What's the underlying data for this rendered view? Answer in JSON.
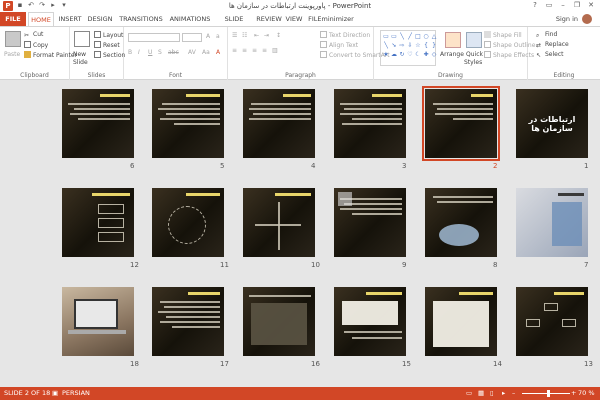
{
  "window": {
    "title": "پاورپوینت ارتباطات در سازمان ها - PowerPoint",
    "app_icon": "P",
    "controls": [
      "?",
      "▭",
      "–",
      "❐",
      "✕"
    ]
  },
  "tabs": {
    "file": "FILE",
    "items": [
      "HOME",
      "INSERT",
      "DESIGN",
      "TRANSITIONS",
      "ANIMATIONS",
      "SLIDE SHOW",
      "REVIEW",
      "VIEW",
      "FILEminimizer"
    ],
    "active_index": 0,
    "sign_in": "Sign in"
  },
  "ribbon": {
    "clipboard": {
      "label": "Clipboard",
      "paste": "Paste",
      "cut": "Cut",
      "copy": "Copy",
      "format_painter": "Format Painter"
    },
    "slides": {
      "label": "Slides",
      "new_slide": "New",
      "new_slide_2": "Slide",
      "layout": "Layout",
      "reset": "Reset",
      "section": "Section"
    },
    "font": {
      "label": "Font"
    },
    "paragraph": {
      "label": "Paragraph",
      "text_direction": "Text Direction",
      "align_text": "Align Text",
      "convert_smartart": "Convert to SmartArt"
    },
    "drawing": {
      "label": "Drawing",
      "arrange": "Arrange",
      "quick_styles": "Quick",
      "quick_styles_2": "Styles",
      "shape_fill": "Shape Fill",
      "shape_outline": "Shape Outline",
      "shape_effects": "Shape Effects"
    },
    "editing": {
      "label": "Editing",
      "find": "Find",
      "replace": "Replace",
      "select": "Select"
    }
  },
  "slides": [
    {
      "num": "1",
      "title": "ارتباطات در سازمان ها"
    },
    {
      "num": "2"
    },
    {
      "num": "3"
    },
    {
      "num": "4"
    },
    {
      "num": "5"
    },
    {
      "num": "6"
    },
    {
      "num": "7"
    },
    {
      "num": "8"
    },
    {
      "num": "9"
    },
    {
      "num": "10"
    },
    {
      "num": "11"
    },
    {
      "num": "12"
    },
    {
      "num": "13"
    },
    {
      "num": "14"
    },
    {
      "num": "15"
    },
    {
      "num": "16"
    },
    {
      "num": "17"
    },
    {
      "num": "18"
    }
  ],
  "selected_slide": "2",
  "status": {
    "slide_info": "SLIDE 2 OF 18",
    "language": "PERSIAN",
    "zoom": "70 %",
    "zoom_fraction": 0.55
  },
  "colors": {
    "accent": "#d24726",
    "slide_title": "#e8d56a"
  }
}
